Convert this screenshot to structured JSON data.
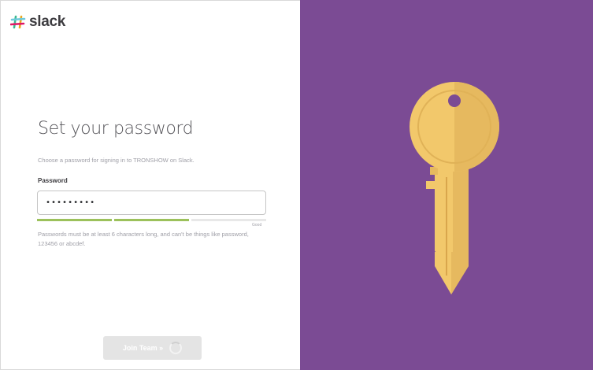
{
  "brand": {
    "name": "slack"
  },
  "form": {
    "title": "Set your password",
    "subtitle": "Choose a password for signing in to TRONSHOW on Slack.",
    "password_label": "Password",
    "password_value": "•••••••••",
    "strength_label": "Good",
    "strength_level": 0.67,
    "help_text": "Passwords must be at least 6 characters long, and can't be things like password, 123456 or abcdef.",
    "submit_label": "Join Team »"
  },
  "colors": {
    "accent_purple": "#7b4b94",
    "key_gold": "#f2c86b",
    "strength_green": "#9cc15b"
  },
  "icons": [
    "slack-logo-icon",
    "loading-spinner-icon",
    "key-illustration"
  ]
}
